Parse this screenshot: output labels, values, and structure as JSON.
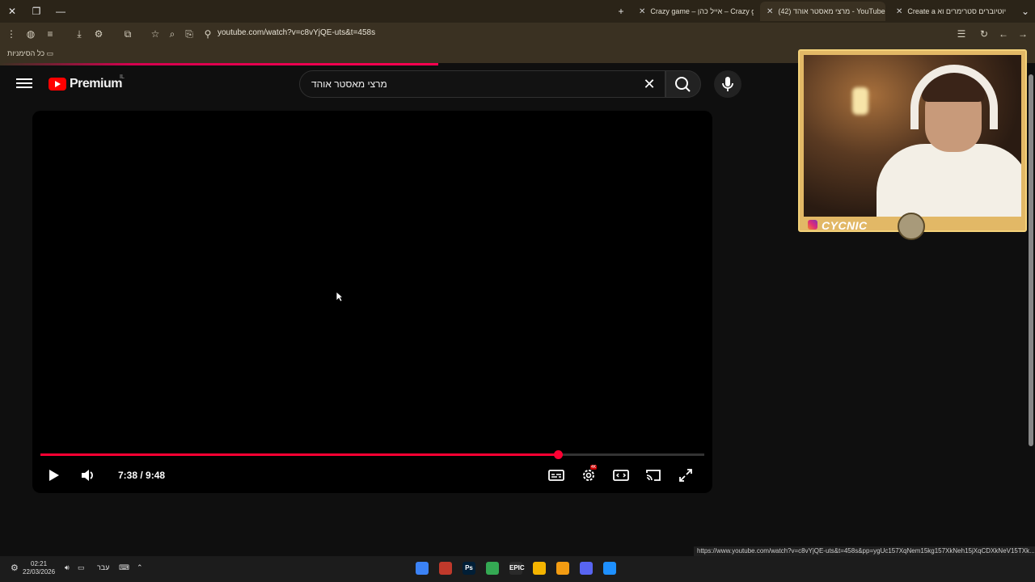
{
  "browser": {
    "tabs": [
      {
        "title": "Create a יוטיוברים סטרימרים וא",
        "active": false
      },
      {
        "title": "(42) מרצי מאסטר אוהד - YouTube",
        "active": true
      },
      {
        "title": "Crazy game – אייל כהן – Crazy g",
        "active": false
      }
    ],
    "url": "youtube.com/watch?v=c8vYjQE-uts&t=458s",
    "bookmarks_label": "כל הסימניות"
  },
  "youtube": {
    "logo_text": "Premium",
    "country_code": "IL",
    "search": {
      "query": "מרצי מאסטר אוהד"
    }
  },
  "player": {
    "current_time": "7:38",
    "duration": "9:48",
    "progress_fraction": 0.779,
    "settings_badge": "4K"
  },
  "overlay": {
    "streamer_name": "CYCNIC"
  },
  "status_bar_url": "https://www.youtube.com/watch?v=c8vYjQE-uts&t=458s&pp=ygUc157XqNem15kg157XkNeh15jXqCDXkNeV15TXk...",
  "taskbar": {
    "time": "02:21",
    "date": "22/03/2026",
    "language": "עבר",
    "apps": [
      {
        "name": "notepad-icon",
        "label": "",
        "color": "#3b82f6"
      },
      {
        "name": "game-icon",
        "label": "",
        "color": "#c0392b"
      },
      {
        "name": "photoshop-icon",
        "label": "Ps",
        "color": "#001e36"
      },
      {
        "name": "chrome-icon",
        "label": "",
        "color": "#34a853"
      },
      {
        "name": "epic-games-icon",
        "label": "EPIC",
        "color": "#2a2a2a"
      },
      {
        "name": "file-explorer-icon",
        "label": "",
        "color": "#f4b400"
      },
      {
        "name": "folder-icon",
        "label": "",
        "color": "#f39c12"
      },
      {
        "name": "discord-icon",
        "label": "",
        "color": "#5865f2"
      },
      {
        "name": "windows-icon",
        "label": "",
        "color": "#1e90ff"
      }
    ]
  }
}
